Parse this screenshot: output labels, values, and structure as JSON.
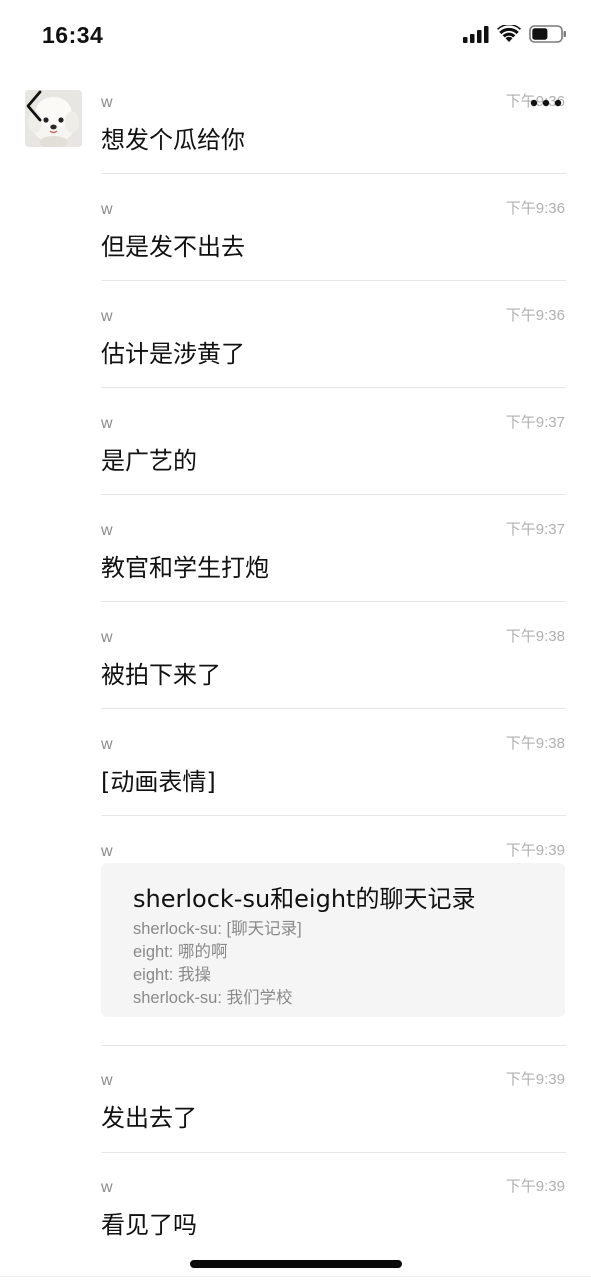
{
  "status_bar": {
    "time": "16:34",
    "battery_level": 0.55,
    "signal_bars": 4,
    "icons": [
      "cellular-signal-icon",
      "wifi-icon",
      "battery-icon"
    ]
  },
  "header": {
    "back_icon": "chevron-left-icon",
    "more_icon": "more-dots-icon"
  },
  "avatar": {
    "icon": "dog-avatar-icon"
  },
  "messages": [
    {
      "sender": "w",
      "time": "下午9:36",
      "text": "想发个瓜给你"
    },
    {
      "sender": "w",
      "time": "下午9:36",
      "text": "但是发不出去"
    },
    {
      "sender": "w",
      "time": "下午9:36",
      "text": "估计是涉黄了"
    },
    {
      "sender": "w",
      "time": "下午9:37",
      "text": "是广艺的"
    },
    {
      "sender": "w",
      "time": "下午9:37",
      "text": "教官和学生打炮"
    },
    {
      "sender": "w",
      "time": "下午9:38",
      "text": "被拍下来了"
    },
    {
      "sender": "w",
      "time": "下午9:38",
      "text": "[动画表情]"
    },
    {
      "sender": "w",
      "time": "下午9:39",
      "card": {
        "title": "sherlock-su和eight的聊天记录",
        "lines": [
          "sherlock-su: [聊天记录]",
          "eight: 哪的啊",
          "eight: 我操",
          "sherlock-su: 我们学校"
        ]
      }
    },
    {
      "sender": "w",
      "time": "下午9:39",
      "text": "发出去了"
    },
    {
      "sender": "w",
      "time": "下午9:39",
      "text": "看见了吗"
    }
  ]
}
